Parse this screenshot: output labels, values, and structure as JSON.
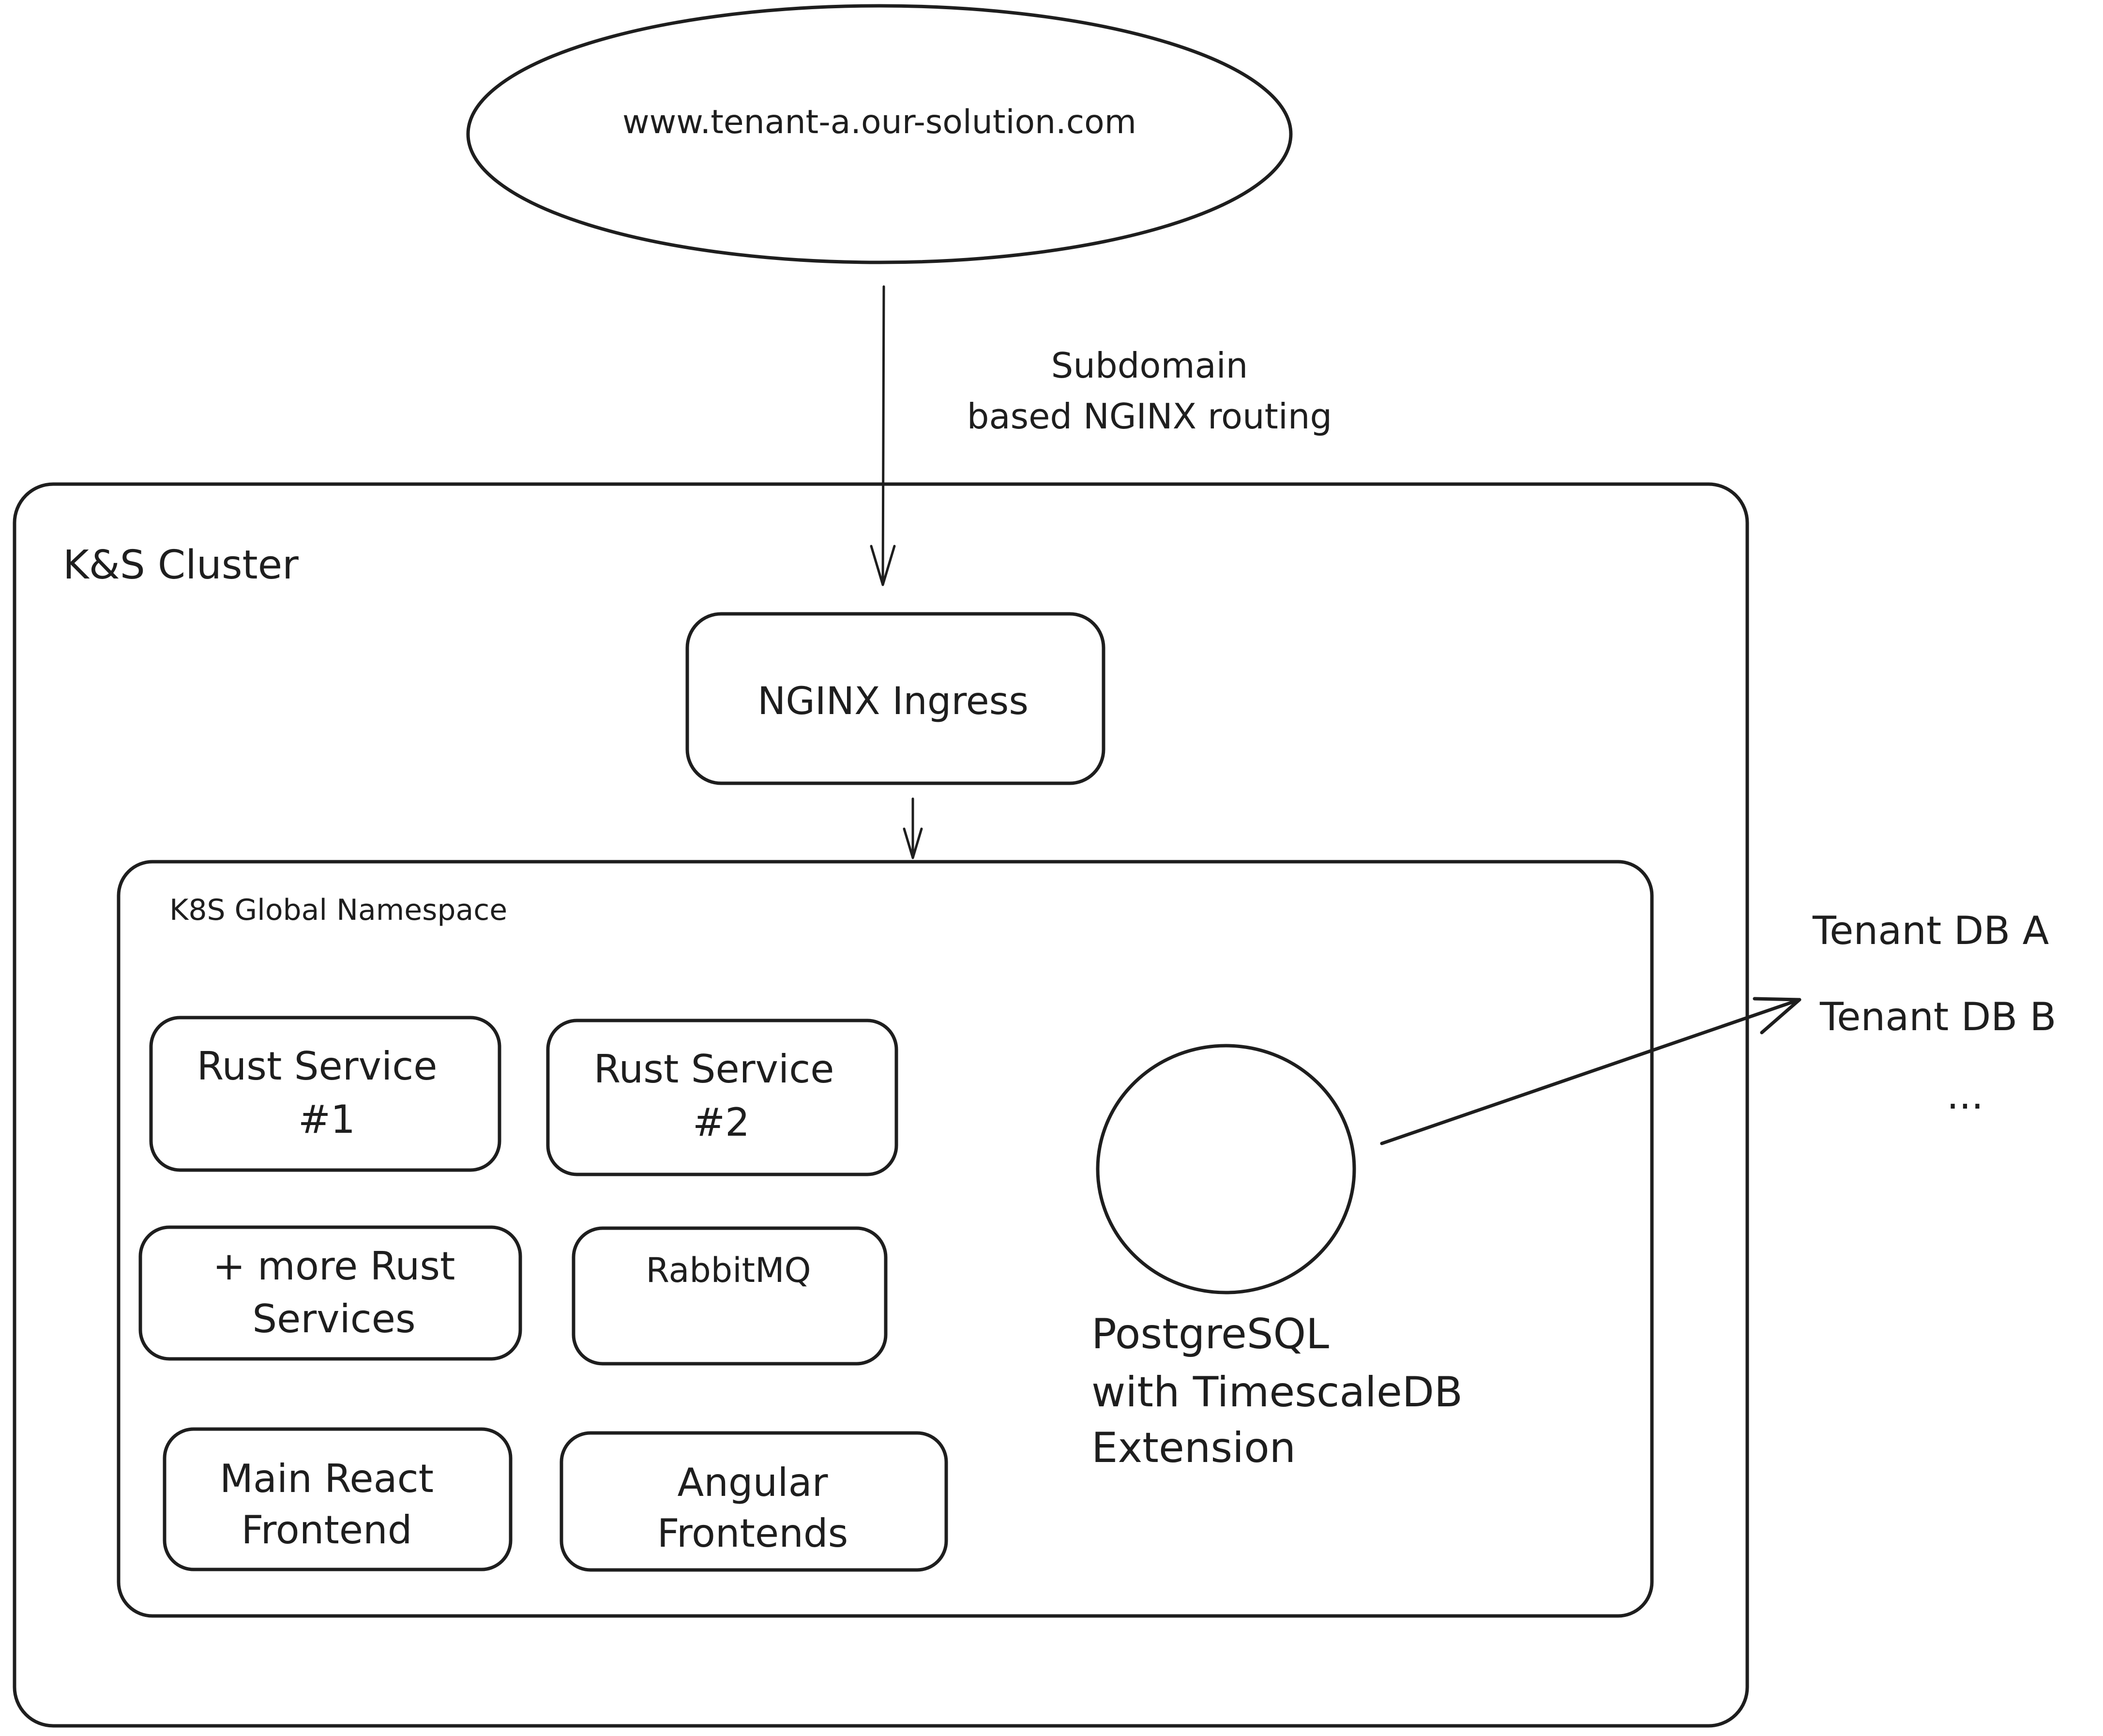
{
  "diagram": {
    "entry_point": {
      "label": "www.tenant-a.our-solution.com"
    },
    "routing_note": {
      "lines": [
        "Subdomain",
        "based NGINX routing"
      ]
    },
    "cluster": {
      "label": "K&S Cluster"
    },
    "ingress": {
      "label": "NGINX Ingress"
    },
    "namespace": {
      "label": "K8S Global Namespace"
    },
    "services": [
      {
        "id": "rust-service-1",
        "lines": [
          "Rust Service",
          "#1"
        ]
      },
      {
        "id": "rust-service-2",
        "lines": [
          "Rust Service",
          "#2"
        ]
      },
      {
        "id": "more-rust-services",
        "lines": [
          "+ more Rust",
          "Services"
        ]
      },
      {
        "id": "rabbitmq",
        "lines": [
          "RabbitMQ"
        ]
      },
      {
        "id": "main-react-frontend",
        "lines": [
          "Main React",
          "Frontend"
        ]
      },
      {
        "id": "angular-frontends",
        "lines": [
          "Angular",
          "Frontends"
        ]
      }
    ],
    "database": {
      "lines": [
        "PostgreSQL",
        "with TimescaleDB",
        "Extension"
      ]
    },
    "tenant_dbs": [
      "Tenant DB A",
      "Tenant DB B",
      "..."
    ],
    "stroke_color": "#1e1e1e",
    "background_color": "#ffffff"
  }
}
